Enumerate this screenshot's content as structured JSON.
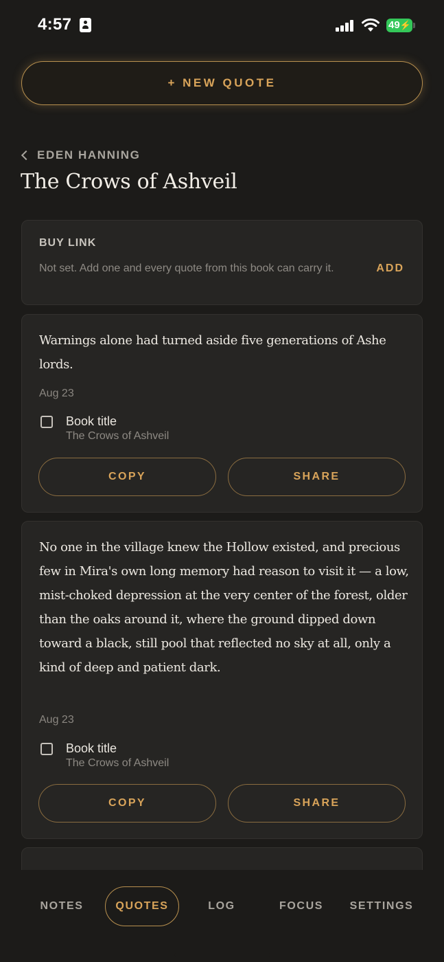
{
  "status_bar": {
    "time": "4:57",
    "battery_level": "49",
    "battery_color": "#34c759",
    "icons": [
      "id-card-icon",
      "signal-icon",
      "wifi-icon",
      "battery-icon"
    ]
  },
  "actions": {
    "new_quote_label": "+ NEW QUOTE"
  },
  "header": {
    "breadcrumb": "EDEN HANNING",
    "title": "The Crows of Ashveil"
  },
  "buy_link": {
    "heading": "BUY LINK",
    "description": "Not set. Add one and every quote from this book can carry it.",
    "action_label": "ADD"
  },
  "quotes": [
    {
      "text": "Warnings alone had turned aside five generations of Ashe lords.",
      "date": "Aug 23",
      "checkbox_label": "Book title",
      "checkbox_sub": "The Crows of Ashveil",
      "checked": false,
      "copy_label": "COPY",
      "share_label": "SHARE"
    },
    {
      "text": "No one in the village knew the Hollow existed, and precious few in Mira's own long memory had reason to visit it — a low, mist-choked depression at the very center of the forest, older than the oaks around it, where the ground dipped down toward a black, still pool that reflected no sky at all, only a kind of deep and patient dark.",
      "date": "Aug 23",
      "checkbox_label": "Book title",
      "checkbox_sub": "The Crows of Ashveil",
      "checked": false,
      "copy_label": "COPY",
      "share_label": "SHARE"
    }
  ],
  "bottom_nav": {
    "tabs": [
      {
        "label": "NOTES",
        "active": false
      },
      {
        "label": "QUOTES",
        "active": true
      },
      {
        "label": "LOG",
        "active": false
      },
      {
        "label": "FOCUS",
        "active": false
      },
      {
        "label": "SETTINGS",
        "active": false
      }
    ]
  },
  "colors": {
    "background": "#1c1b19",
    "card": "#262523",
    "accent": "#d9a45a",
    "accent_border": "#b8904f"
  }
}
